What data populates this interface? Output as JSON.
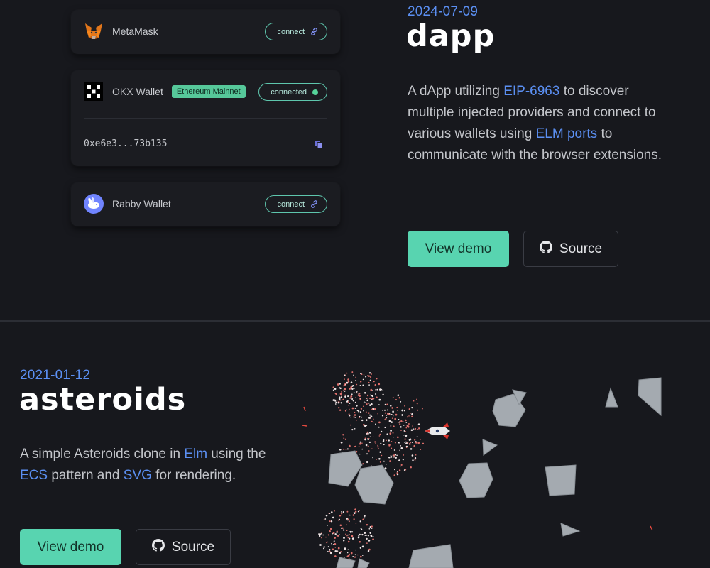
{
  "dapp": {
    "wallets": [
      {
        "name": "MetaMask",
        "button": "connect",
        "logo": "metamask-fox-icon",
        "status": "disconnected"
      },
      {
        "name": "OKX Wallet",
        "badge": "Ethereum Mainnet",
        "button": "connected",
        "logo": "okx-logo-icon",
        "status": "connected",
        "address": "0xe6e3...73b135"
      },
      {
        "name": "Rabby Wallet",
        "button": "connect",
        "logo": "rabby-logo-icon",
        "status": "disconnected"
      }
    ],
    "date": "2024-07-09",
    "title": "dapp",
    "description": {
      "p1": "A dApp utilizing ",
      "link1": "EIP-6963",
      "p2": " to discover multiple injected providers and connect to various wallets using ",
      "link2": "ELM ports",
      "p3": " to communicate with the browser extensions."
    },
    "demo_label": "View demo",
    "source_label": "Source"
  },
  "asteroids": {
    "date": "2021-01-12",
    "title": "asteroids",
    "description": {
      "p1": "A simple Asteroids clone in ",
      "link1": "Elm",
      "p2": " using the ",
      "link2": "ECS",
      "p3": " pattern and ",
      "link3": "SVG",
      "p4": " for rendering."
    },
    "demo_label": "View demo",
    "source_label": "Source"
  },
  "colors": {
    "background": "#17181d",
    "card": "#1b1c21",
    "accent_teal": "#58d4b0",
    "link_blue": "#5b8ff2",
    "badge_green": "#56c89a",
    "asteroid_gray": "#a4aab0"
  }
}
